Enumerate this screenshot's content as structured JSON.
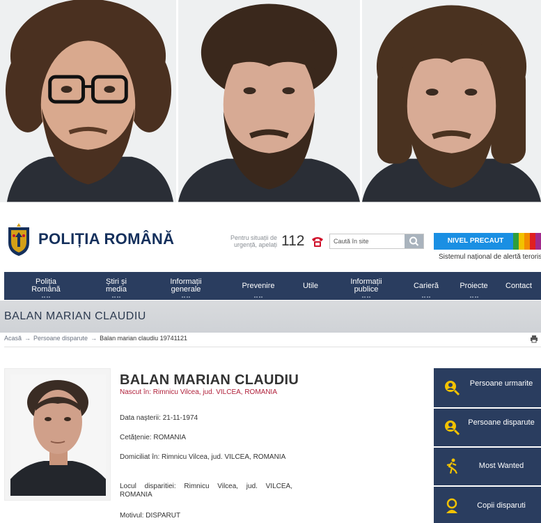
{
  "header": {
    "brand": "POLIȚIA ROMÂNĂ",
    "urgency_text": "Pentru situații de urgență, apelați",
    "emergency_number": "112",
    "search_placeholder": "Caută în site",
    "alert_button": "NIVEL PRECAUT",
    "alert_subtitle": "Sistemul național de alertă teroristă",
    "alert_colors": [
      "#2e9e3c",
      "#f2c200",
      "#f28c00",
      "#e02020",
      "#a12a8c"
    ]
  },
  "nav": {
    "items": [
      {
        "label": "Poliția Română",
        "dots": true
      },
      {
        "label": "Știri și media",
        "dots": true
      },
      {
        "label": "Informații generale",
        "dots": true
      },
      {
        "label": "Prevenire",
        "dots": true
      },
      {
        "label": "Utile",
        "dots": false
      },
      {
        "label": "Informații publice",
        "dots": true
      },
      {
        "label": "Carieră",
        "dots": true
      },
      {
        "label": "Proiecte",
        "dots": true
      },
      {
        "label": "Contact",
        "dots": false
      }
    ]
  },
  "page": {
    "title": "BALAN MARIAN CLAUDIU"
  },
  "breadcrumb": {
    "items": [
      "Acasă",
      "Persoane disparute",
      "Balan marian claudiu 19741121"
    ],
    "separator": "→"
  },
  "person": {
    "name": "BALAN MARIAN CLAUDIU",
    "born": "Nascut în: Rimnicu Vilcea, jud. VILCEA, ROMANIA",
    "birth_label": "Data nașterii:",
    "birth_value": "21-11-1974",
    "citizenship_label": "Cetățenie:",
    "citizenship_value": "ROMANIA",
    "domicile_label": "Domiciliat în:",
    "domicile_value": "Rimnicu Vilcea, jud. VILCEA, ROMANIA",
    "disappear_label": "Locul disparitiei:",
    "disappear_value": "Rimnicu Vilcea, jud. VILCEA, ROMANIA",
    "reason_label": "Motivul:",
    "reason_value": "DISPARUT"
  },
  "sidebar": {
    "items": [
      {
        "label": "Persoane urmarite",
        "icon": "magnifier-person-icon"
      },
      {
        "label": "Persoane disparute",
        "icon": "magnifier-person-icon"
      },
      {
        "label": "Most Wanted",
        "icon": "running-man-icon"
      },
      {
        "label": "Copii disparuti",
        "icon": "child-icon"
      }
    ]
  }
}
